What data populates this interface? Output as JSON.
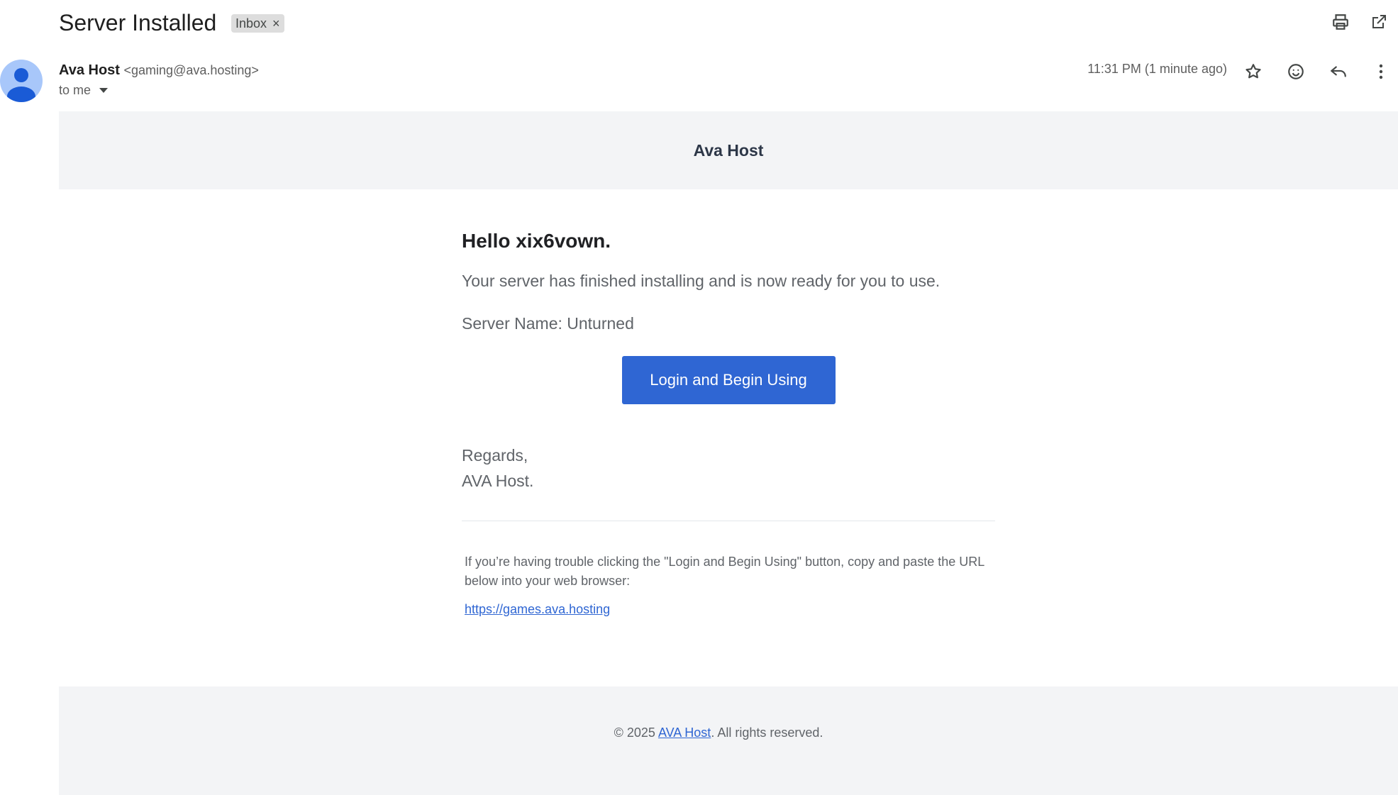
{
  "header": {
    "subject": "Server Installed",
    "label": "Inbox",
    "label_remove": "×"
  },
  "sender": {
    "name": "Ava Host",
    "email": "<gaming@ava.hosting>",
    "to": "to me",
    "timestamp": "11:31 PM (1 minute ago)"
  },
  "email": {
    "brand": "Ava Host",
    "greeting": "Hello xix6vown.",
    "line1": "Your server has finished installing and is now ready for you to use.",
    "line2": "Server Name: Unturned",
    "button_label": "Login and Begin Using",
    "regards": "Regards,",
    "signature": "AVA Host.",
    "trouble_text": "If you’re having trouble clicking the \"Login and Begin Using\" button, copy and paste the URL below into your web browser:",
    "url": "https://games.ava.hosting",
    "footer_prefix": "© 2025 ",
    "footer_link": "AVA Host",
    "footer_suffix": ". All rights reserved."
  },
  "icons": {
    "top": [
      "print-icon",
      "open-in-new-window-icon"
    ],
    "actions": [
      "star-icon",
      "emoji-reaction-icon",
      "reply-icon",
      "more-options-icon"
    ]
  },
  "colors": {
    "accent": "#2f66d3",
    "avatar": "#a8c7fa",
    "band": "#f3f4f6"
  }
}
